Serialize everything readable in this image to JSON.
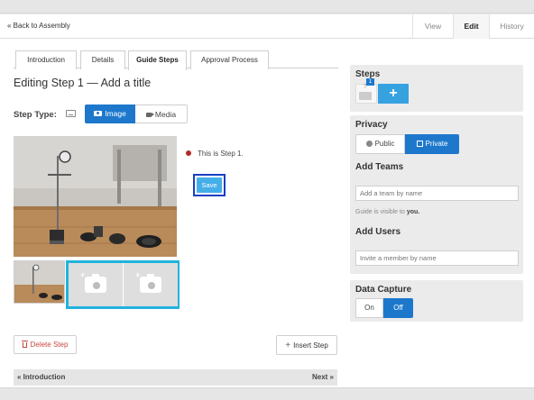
{
  "header": {
    "back_link": "« Back to Assembly",
    "tabs": [
      "View",
      "Edit",
      "History"
    ]
  },
  "guide_tabs": [
    "Introduction",
    "Details",
    "Guide Steps",
    "Approval Process"
  ],
  "editor": {
    "title": "Editing Step 1 — Add a title",
    "step_type_label": "Step Type:",
    "step_type_options": [
      "Image",
      "Media"
    ],
    "selected_step_type": "Image",
    "step_line_text": "This is Step 1.",
    "save_label": "Save",
    "delete_label": "Delete Step",
    "insert_label": "Insert Step",
    "pager_prev": "« Introduction",
    "pager_next": "Next »"
  },
  "sidebar": {
    "steps": {
      "title": "Steps",
      "count_badge": "1",
      "thumb_mark": "?",
      "add_symbol": "+"
    },
    "privacy": {
      "title": "Privacy",
      "options": [
        "Public",
        "Private"
      ],
      "selected": "Private"
    },
    "teams": {
      "title": "Add Teams",
      "placeholder": "Add a team by name",
      "note_prefix": "Guide is visible to",
      "note_bold": "you."
    },
    "users": {
      "title": "Add Users",
      "placeholder": "Invite a member by name"
    },
    "data_capture": {
      "title": "Data Capture",
      "options": [
        "On",
        "Off"
      ],
      "selected": "Off"
    }
  },
  "colors": {
    "accent_blue": "#1d78cc",
    "light_blue": "#36a2e0",
    "highlight_cyan": "#22b2dd",
    "save_outline": "#1a3fc4",
    "delete_red": "#c9473d",
    "bullet_red": "#b02a2a"
  }
}
